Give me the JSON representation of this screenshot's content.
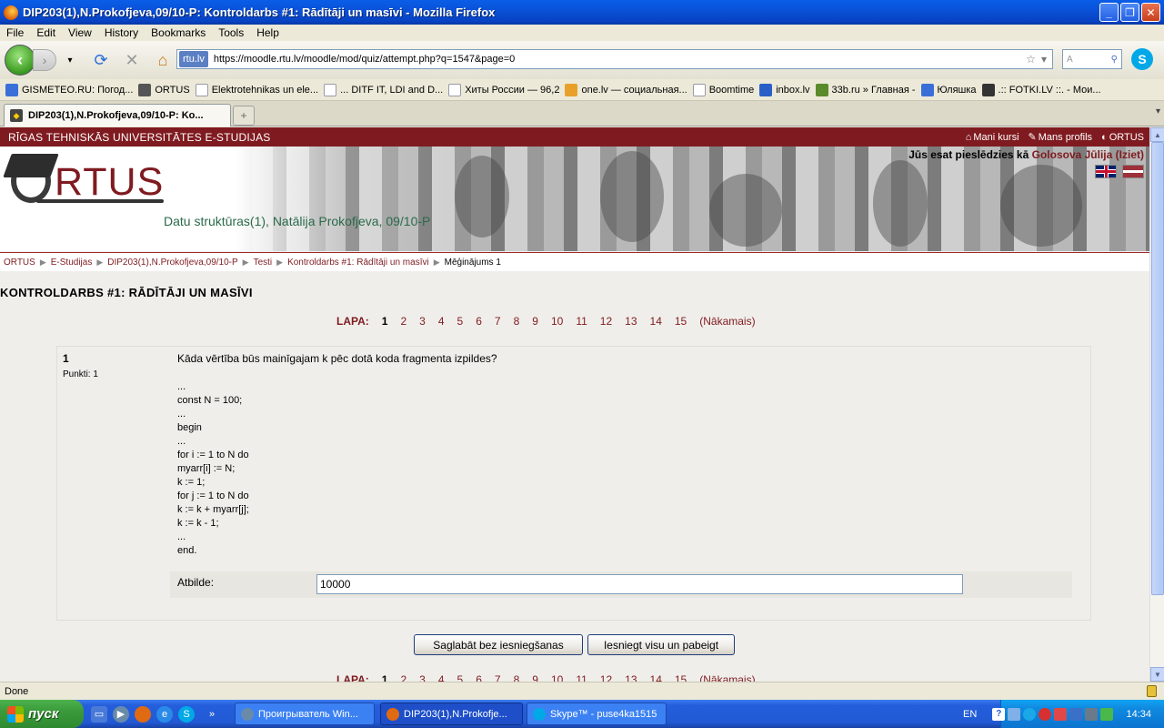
{
  "window": {
    "title": "DIP203(1),N.Prokofjeva,09/10-P: Kontroldarbs #1: Rādītāji un masīvi - Mozilla Firefox"
  },
  "menu": [
    "File",
    "Edit",
    "View",
    "History",
    "Bookmarks",
    "Tools",
    "Help"
  ],
  "navbar": {
    "site_identity": "rtu.lv",
    "url": "https://moodle.rtu.lv/moodle/mod/quiz/attempt.php?q=1547&page=0",
    "search_hint": "A"
  },
  "bookmarks": [
    {
      "label": "GISMETEO.RU: Погод...",
      "icon": "weather-icon",
      "color": "#3a6fd8"
    },
    {
      "label": "ORTUS",
      "icon": "ortus-icon",
      "color": "#555"
    },
    {
      "label": "Elektrotehnikas un ele...",
      "icon": "page-icon",
      "color": "#fff"
    },
    {
      "label": "... DITF IT, LDI and D...",
      "icon": "page-icon",
      "color": "#fff"
    },
    {
      "label": "Хиты России — 96,2",
      "icon": "page-icon",
      "color": "#fff"
    },
    {
      "label": "one.lv — социальная...",
      "icon": "one-lv-icon",
      "color": "#e8a02a"
    },
    {
      "label": "Boomtime",
      "icon": "boomtime-icon",
      "color": "#fff"
    },
    {
      "label": "inbox.lv",
      "icon": "mail-icon",
      "color": "#2a5fc8"
    },
    {
      "label": "33b.ru » Главная -",
      "icon": "people-icon",
      "color": "#5a8a2a"
    },
    {
      "label": "Юляшка",
      "icon": "pen-icon",
      "color": "#3a6fd8"
    },
    {
      "label": ".:: FOTKI.LV ::. - Мои...",
      "icon": "fotki-icon",
      "color": "#333"
    }
  ],
  "tab": {
    "label": "DIP203(1),N.Prokofjeva,09/10-P: Ko..."
  },
  "site": {
    "name": "RĪGAS TEHNISKĀS UNIVERSITĀTES E-STUDIJAS",
    "links": [
      "Mani kursi",
      "Mans profils",
      "ORTUS"
    ],
    "logo_text": "RTUS",
    "course_title": "Datu struktūras(1), Natālija Prokofjeva, 09/10-P",
    "login_prefix": "Jūs esat pieslēdzies kā",
    "login_name": "Golosova Jūlija",
    "logout": "Iziet"
  },
  "breadcrumb": {
    "items": [
      "ORTUS",
      "E-Studijas",
      "DIP203(1),N.Prokofjeva,09/10-P",
      "Testi",
      "Kontroldarbs #1: Rādītāji un masīvi"
    ],
    "current": "Mēģinājums 1"
  },
  "quiz": {
    "title": "KONTROLDARBS #1: RĀDĪTĀJI UN MASĪVI",
    "pager_label": "LAPA:",
    "pages": [
      "1",
      "2",
      "3",
      "4",
      "5",
      "6",
      "7",
      "8",
      "9",
      "10",
      "11",
      "12",
      "13",
      "14",
      "15"
    ],
    "current_page": "1",
    "next_label": "(Nākamais)"
  },
  "question": {
    "number": "1",
    "points": "Punkti: 1",
    "text": "Kāda vērtība būs mainīgajam k pēc dotā koda fragmenta izpildes?",
    "code": [
      "...",
      "const N = 100;",
      "...",
      "begin",
      "...",
      "for i := 1 to N do",
      "myarr[i] := N;",
      "k := 1;",
      "for j := 1 to N do",
      "k := k + myarr[j];",
      "k := k - 1;",
      "...",
      "end."
    ],
    "answer_label": "Atbilde:",
    "answer_value": "10000"
  },
  "buttons": {
    "save": "Saglabāt bez iesniegšanas",
    "submit": "Iesniegt visu un pabeigt"
  },
  "status": "Done",
  "taskbar": {
    "start": "пуск",
    "tasks": [
      "Проигрыватель Win...",
      "DIP203(1),N.Prokofje...",
      "Skype™ - puse4ka1515"
    ],
    "lang": "EN",
    "clock": "14:34"
  }
}
